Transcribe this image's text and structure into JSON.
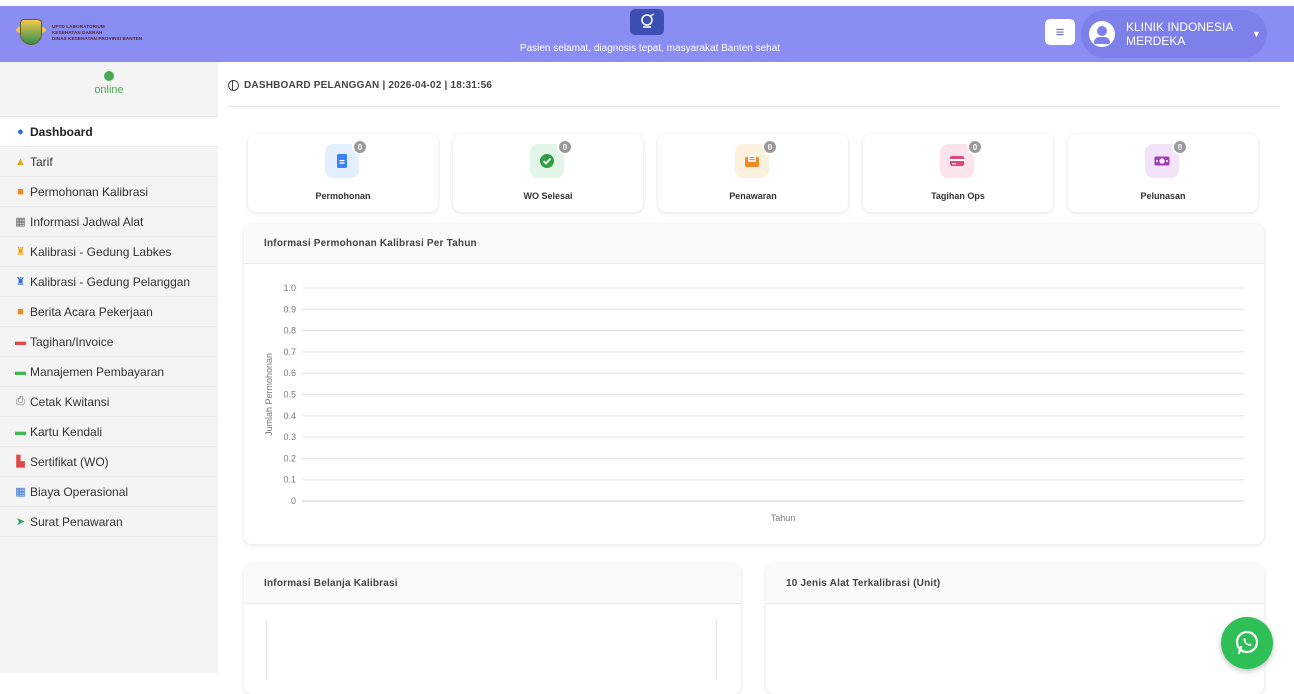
{
  "header": {
    "logo_lines": [
      "UPTD LABORATORIUM",
      "KESEHATAN DAERAH",
      "DINAS KESEHATAN PROVINSI BANTEN"
    ],
    "tagline": "Pasien selamat, diagnosis tepat, masyarakat Banten sehat",
    "user_name": "KLINIK INDONESIA MERDEKA",
    "brand_color": "#8a8df2"
  },
  "sidebar": {
    "status": "online",
    "items": [
      {
        "label": "Dashboard",
        "icon": "dashboard-icon",
        "color": "#2f6fd6"
      },
      {
        "label": "Tarif",
        "icon": "hand-coin-icon",
        "color": "#e8a318"
      },
      {
        "label": "Permohonan Kalibrasi",
        "icon": "folder-icon",
        "color": "#f08a24"
      },
      {
        "label": "Informasi Jadwal Alat",
        "icon": "calendar-icon",
        "color": "#666666"
      },
      {
        "label": "Kalibrasi - Gedung Labkes",
        "icon": "microscope-icon",
        "color": "#e8a318"
      },
      {
        "label": "Kalibrasi - Gedung Pelanggan",
        "icon": "microscope-icon",
        "color": "#2f6fd6"
      },
      {
        "label": "Berita Acara Pekerjaan",
        "icon": "folder-icon",
        "color": "#f08a24"
      },
      {
        "label": "Tagihan/Invoice",
        "icon": "invoice-icon",
        "color": "#e04848"
      },
      {
        "label": "Manajemen Pembayaran",
        "icon": "money-icon",
        "color": "#3cba54"
      },
      {
        "label": "Cetak Kwitansi",
        "icon": "printer-icon",
        "color": "#666666"
      },
      {
        "label": "Kartu Kendali",
        "icon": "card-icon",
        "color": "#3cba54"
      },
      {
        "label": "Sertifikat (WO)",
        "icon": "certificate-icon",
        "color": "#e04848"
      },
      {
        "label": "Biaya Operasional",
        "icon": "calculator-icon",
        "color": "#2f6fd6"
      },
      {
        "label": "Surat Penawaran",
        "icon": "send-icon",
        "color": "#2e9e63"
      }
    ]
  },
  "main": {
    "breadcrumb": "DASHBOARD PELANGGAN | 2026-04-02 | 18:31:56",
    "stats": [
      {
        "label": "Permohonan",
        "count": "0",
        "icon": "document-icon",
        "bg": "#e3effd",
        "color": "#3b82f6"
      },
      {
        "label": "WO Selesai",
        "count": "0",
        "icon": "check-circle-icon",
        "bg": "#e2f5e6",
        "color": "#2f9e44"
      },
      {
        "label": "Penawaran",
        "count": "0",
        "icon": "mail-open-icon",
        "bg": "#fdf0dc",
        "color": "#f08a24"
      },
      {
        "label": "Tagihan Ops",
        "count": "0",
        "icon": "credit-card-icon",
        "bg": "#fde4ec",
        "color": "#e0457b"
      },
      {
        "label": "Pelunasan",
        "count": "0",
        "icon": "money-bill-icon",
        "bg": "#f3e3f7",
        "color": "#a23cbf"
      }
    ],
    "panel_permohonan_title": "Informasi Permohonan Kalibrasi Per Tahun",
    "panel_belanja_title": "Informasi Belanja Kalibrasi",
    "panel_alat_title": "10 Jenis Alat Terkalibrasi (Unit)"
  },
  "chart_data": {
    "type": "line",
    "title": "",
    "xlabel": "Tahun",
    "ylabel": "Jumlah Permohonan",
    "ylim": [
      0,
      1.0
    ],
    "yticks": [
      "0",
      "0.1",
      "0.2",
      "0.3",
      "0.4",
      "0.5",
      "0.6",
      "0.7",
      "0.8",
      "0.9",
      "1.0"
    ],
    "x": [],
    "series": [],
    "grid": true
  }
}
